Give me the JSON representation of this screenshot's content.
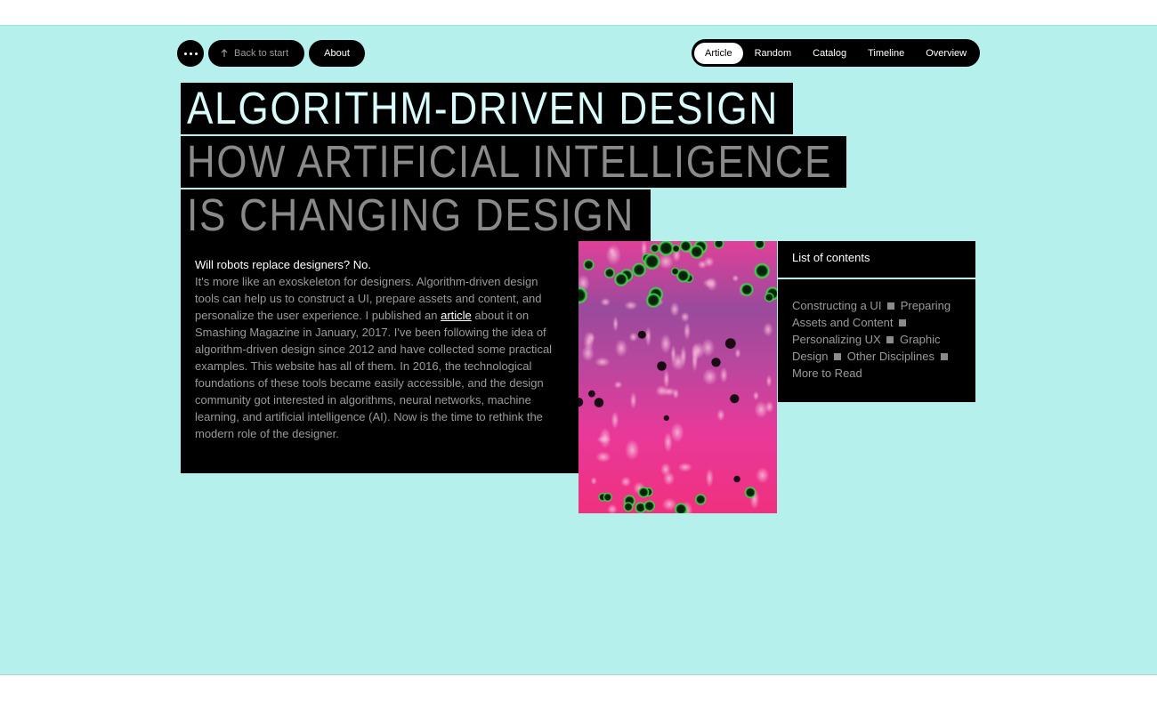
{
  "nav": {
    "back_label": "Back to start",
    "about_label": "About",
    "tabs": [
      {
        "label": "Article",
        "active": true
      },
      {
        "label": "Random"
      },
      {
        "label": "Catalog"
      },
      {
        "label": "Timeline"
      },
      {
        "label": "Overview"
      }
    ]
  },
  "headline": {
    "line1": "ALGORITHM-DRIVEN DESIGN",
    "line2": "HOW ARTIFICIAL INTELLIGENCE",
    "line3": "IS CHANGING DESIGN"
  },
  "intro": {
    "lead": "Will robots replace designers? No.",
    "text_before_link": "It's more like an exoskeleton for designers. Algorithm-driven design tools can help us to construct a UI, prepare assets and content, and personalize the user experience. I published an",
    "link_label": "article",
    "text_after_link": "about it on Smashing Magazine in January, 2017. I've been following the idea of algorithm-driven design since 2012 and have collected some practical examples. This website has all of them. In 2016, the technological foundations of these tools became easily accessible, and the design community got interested in algorithms, neural networks, machine learning, and artificial intelligence (AI). Now is the time to rethink the modern role of the designer."
  },
  "contents": {
    "title": "List of contents",
    "items": [
      "Constructing a UI",
      "Preparing Assets and Content",
      "Personalizing UX",
      "Graphic Design",
      "Other Disciplines",
      "More to Read"
    ]
  },
  "colors": {
    "background": "#b5f0ec",
    "panel": "#000000",
    "headline_primary": "#d9fbfa",
    "headline_secondary": "#8a8a8a",
    "art_magenta": "#f0359a",
    "art_green": "#3ee04a"
  },
  "icons": {
    "menu": "ellipsis-icon",
    "back": "arrow-up-icon"
  }
}
